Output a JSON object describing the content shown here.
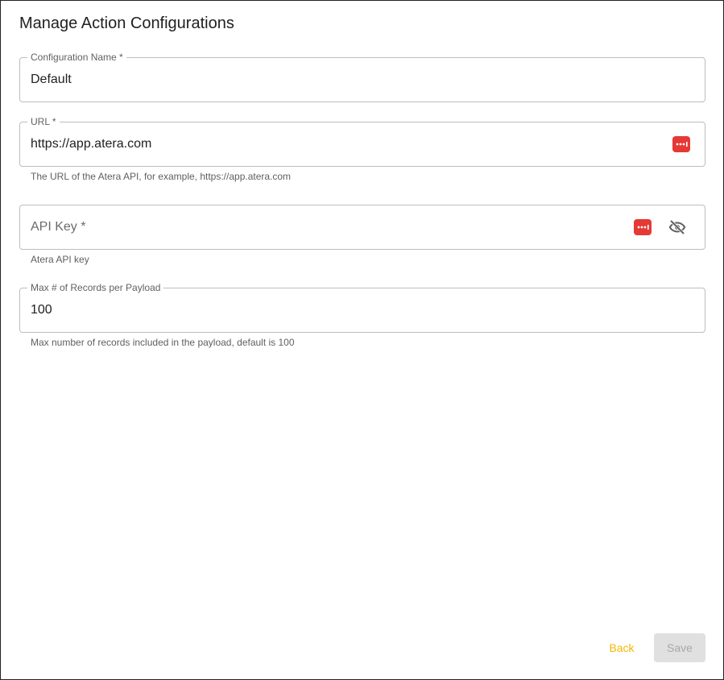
{
  "dialog": {
    "title": "Manage Action Configurations"
  },
  "fields": {
    "config_name": {
      "label": "Configuration Name *",
      "value": "Default"
    },
    "url": {
      "label": "URL *",
      "value": "https://app.atera.com",
      "helper": "The URL of the Atera API, for example, https://app.atera.com",
      "icon": "password-manager-icon"
    },
    "api_key": {
      "placeholder": "API Key *",
      "helper": "Atera API key",
      "icons": [
        "password-manager-icon",
        "eye-off-icon"
      ]
    },
    "max_records": {
      "label": "Max # of Records per Payload",
      "value": "100",
      "helper": "Max number of records included in the payload, default is 100"
    }
  },
  "actions": {
    "back_label": "Back",
    "save_label": "Save"
  },
  "colors": {
    "accent": "#f5b700",
    "password_manager": "#e53935",
    "disabled_bg": "#e0e0e0",
    "disabled_text": "#a8a8a8"
  }
}
